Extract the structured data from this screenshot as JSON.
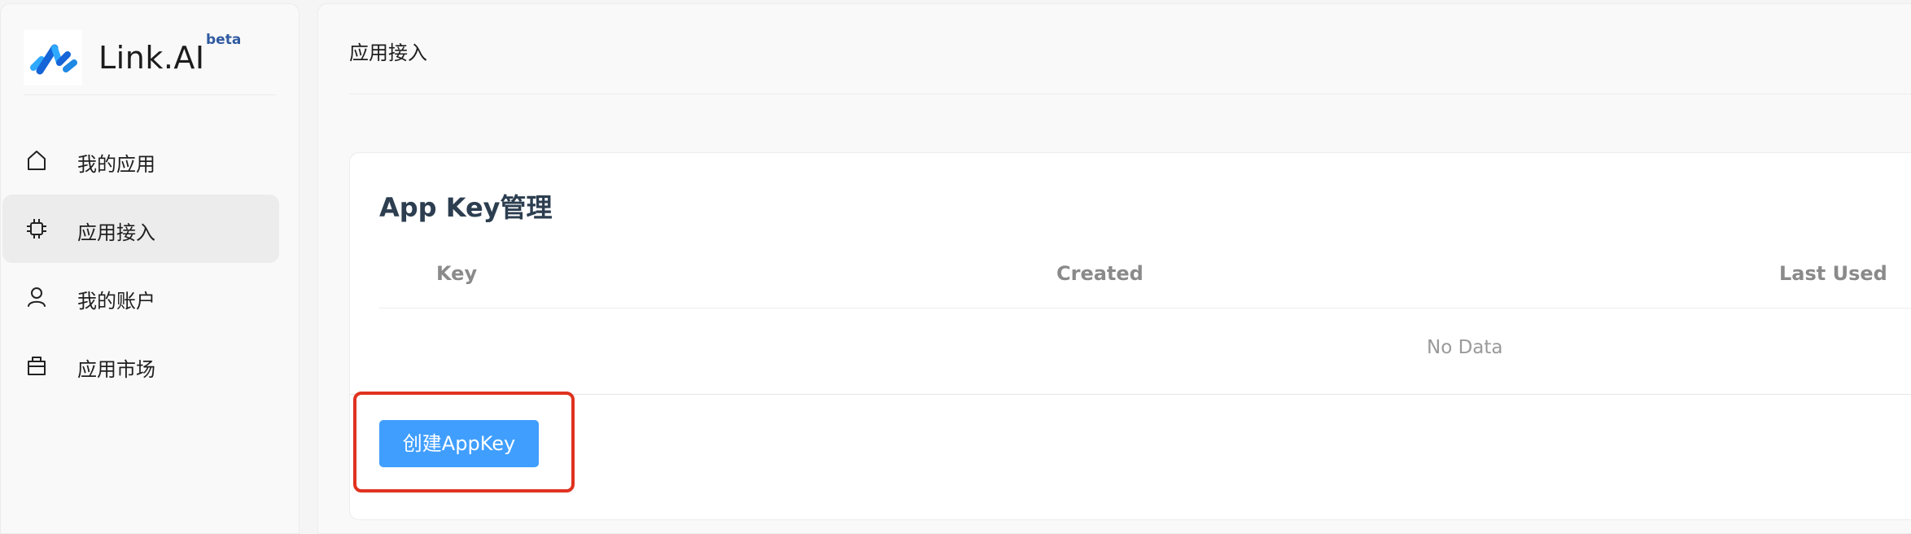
{
  "brand": {
    "name": "Link.AI",
    "badge": "beta",
    "colors": {
      "logo_dark": "#1565d8",
      "logo_light": "#2ea9ff"
    }
  },
  "sidebar": {
    "items": [
      {
        "label": "我的应用",
        "icon": "home-icon",
        "active": false
      },
      {
        "label": "应用接入",
        "icon": "chip-icon",
        "active": true
      },
      {
        "label": "我的账户",
        "icon": "user-icon",
        "active": false
      },
      {
        "label": "应用市场",
        "icon": "shopping-bag-icon",
        "active": false
      }
    ]
  },
  "header": {
    "title": "应用接入"
  },
  "appkey_card": {
    "title": "App Key管理",
    "columns": [
      "Key",
      "Created",
      "Last Used"
    ],
    "rows": [],
    "empty_text": "No Data",
    "create_button_label": "创建AppKey"
  },
  "colors": {
    "primary_button": "#409eff",
    "highlight": "#e0321f",
    "active_nav_bg": "#ececec"
  }
}
